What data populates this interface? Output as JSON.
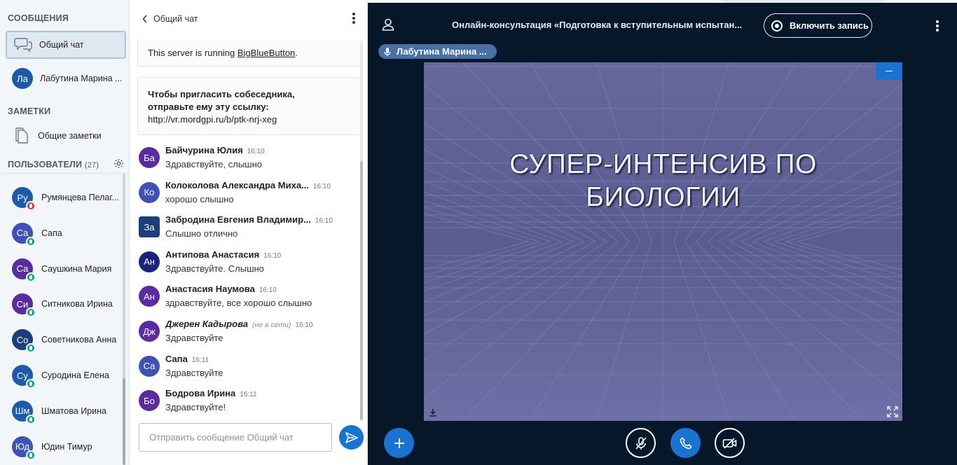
{
  "sidebar": {
    "messages_title": "СООБЩЕНИЯ",
    "public_chat": "Общий чат",
    "private_chat": {
      "initials": "Ла",
      "name": "Лабутина Марина ...",
      "color": "#1e5aa8"
    },
    "notes_title": "ЗАМЕТКИ",
    "shared_notes": "Общие заметки",
    "users_title": "ПОЛЬЗОВАТЕЛИ",
    "users_count": "(27)",
    "users": [
      {
        "initials": "Ру",
        "name": "Румянцева Пелаг...",
        "color": "#1e5aa8",
        "badge": "red"
      },
      {
        "initials": "Са",
        "name": "Сапа",
        "color": "#3f51b5",
        "badge": "green"
      },
      {
        "initials": "Са",
        "name": "Саушкина Мария",
        "color": "#5b2c9f",
        "badge": "green"
      },
      {
        "initials": "Си",
        "name": "Ситникова Ирина",
        "color": "#5b2c9f",
        "badge": "green"
      },
      {
        "initials": "Со",
        "name": "Советникова Анна",
        "color": "#1a3f7a",
        "badge": "green"
      },
      {
        "initials": "Су",
        "name": "Суродина Елена",
        "color": "#1e5aa8",
        "badge": "green"
      },
      {
        "initials": "Шм",
        "name": "Шматова Ирина",
        "color": "#1e5aa8",
        "badge": "green"
      },
      {
        "initials": "Юд",
        "name": "Юдин Тимур",
        "color": "#3f51b5",
        "badge": "green"
      }
    ]
  },
  "chat": {
    "title": "Общий чат",
    "server_text": "This server is running ",
    "server_link": "BigBlueButton",
    "server_dot": ".",
    "invite_line1": "Чтобы пригласить собеседника,",
    "invite_line2": "отправьте ему эту ссылку:",
    "invite_url": "http://vr.mordgpi.ru/b/ptk-nrj-xeg",
    "messages": [
      {
        "initials": "Ба",
        "name": "Байчурина Юлия",
        "time": "16:10",
        "text": "Здравствуйте, слышно",
        "color": "#5b2c9f",
        "square": false,
        "offline": ""
      },
      {
        "initials": "Ко",
        "name": "Колоколова Александра Миха...",
        "time": "16:10",
        "text": "хорошо слышно",
        "color": "#3f51b5",
        "square": false,
        "offline": ""
      },
      {
        "initials": "За",
        "name": "Забродина Евгения Владимир...",
        "time": "16:10",
        "text": "Слышно отлично",
        "color": "#1a3f7a",
        "square": true,
        "offline": ""
      },
      {
        "initials": "Ан",
        "name": "Антипова Анастасия",
        "time": "16:10",
        "text": "Здравствуйте. Слышно",
        "color": "#1a237e",
        "square": false,
        "offline": ""
      },
      {
        "initials": "Ан",
        "name": "Анастасия Наумова",
        "time": "16:10",
        "text": "здравствуйте, все хорошо слышно",
        "color": "#5b2c9f",
        "square": false,
        "offline": ""
      },
      {
        "initials": "Дж",
        "name": "Джерен Кадырова",
        "time": "16:10",
        "text": "Здравствуйте",
        "color": "#5b2c9f",
        "square": false,
        "offline": "(не в сети)"
      },
      {
        "initials": "Са",
        "name": "Сапа",
        "time": "16:11",
        "text": "Здравствуйте",
        "color": "#3f51b5",
        "square": false,
        "offline": ""
      },
      {
        "initials": "Бо",
        "name": "Бодрова Ирина",
        "time": "16:11",
        "text": "Здравствуйте!",
        "color": "#5b2c9f",
        "square": false,
        "offline": ""
      }
    ],
    "input_placeholder": "Отправить сообщение Общий чат"
  },
  "main": {
    "meeting_title": "Онлайн-консультация «Подготовка к вступительным испытан...",
    "record_label": "Включить запись",
    "talker": "Лабутина Марина ...",
    "slide_title_line1": "СУПЕР-ИНТЕНСИВ ПО",
    "slide_title_line2": "БИОЛОГИИ"
  },
  "icons": {
    "chat": "chat-bubbles-icon",
    "notes": "notes-icon",
    "settings": "gear-icon",
    "mic": "microphone-icon",
    "user": "user-icon",
    "download": "download-icon",
    "fullscreen": "fullscreen-icon",
    "plus": "plus-icon",
    "mute": "mic-off-icon",
    "phone": "phone-icon",
    "camera_off": "camera-off-icon",
    "send": "send-icon"
  },
  "colors": {
    "accent": "#1b73d1",
    "main_bg": "#06172a",
    "slide_bg": "#5c5c92"
  }
}
